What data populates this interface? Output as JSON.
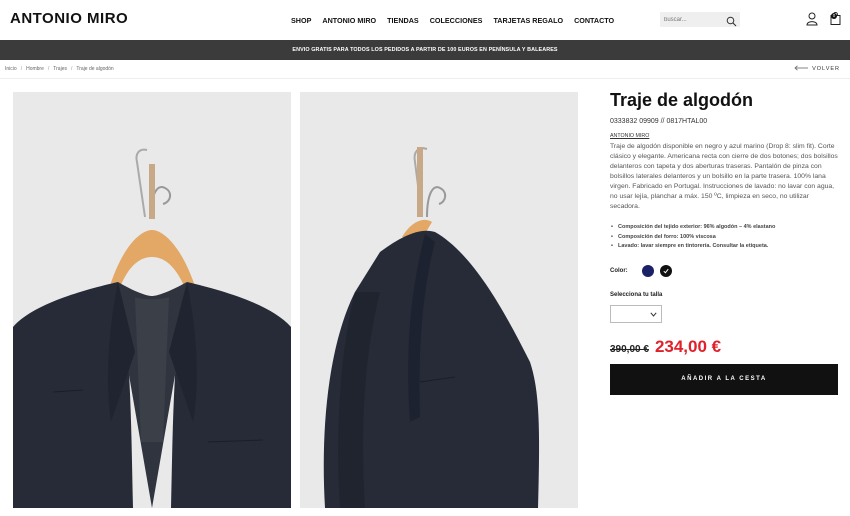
{
  "header": {
    "logo": "ANTONIO MIRO",
    "nav": [
      "SHOP",
      "ANTONIO MIRO",
      "TIENDAS",
      "COLECCIONES",
      "TARJETAS REGALO",
      "CONTACTO"
    ],
    "search_placeholder": "buscar...",
    "cart_count": "0"
  },
  "promo": "ENVIO GRATIS PARA TODOS LOS PEDIDOS A PARTIR DE 100 EUROS EN PENÍNSULA Y BALEARES",
  "breadcrumb": [
    "Inicio",
    "Hombre",
    "Trajes",
    "Traje de algodón"
  ],
  "back_label": "VOLVER",
  "product": {
    "title": "Traje de algodón",
    "ref": "0333832 09909 // 0817HTAL00",
    "brand": "ANTONIO MIRO",
    "description": "Traje de algodón disponible en negro y azul marino (Drop 8: slim fit). Corte clásico y elegante. Americana recta con cierre de dos botones; dos bolsillos delanteros con tapeta y dos aberturas traseras. Pantalón de pinza con bolsillos laterales delanteros y un bolsillo en la parte trasera. 100% lana virgen. Fabricado en Portugal. Instrucciones de lavado: no lavar con agua, no usar lejía, planchar a máx. 150 ºC, limpieza en seco, no utilizar secadora.",
    "bullets": [
      "Composición del tejido exterior: 96% algodón – 4% elastano",
      "Composición del forro: 100% viscosa",
      "Lavado: lavar siempre en tintorería. Consultar la etiqueta."
    ],
    "color_label": "Color:",
    "colors": [
      "#1b2166",
      "#111111"
    ],
    "size_label": "Selecciona tu talla",
    "old_price": "390,00 €",
    "new_price": "234,00 €",
    "add_to_cart": "AÑADIR A LA CESTA"
  }
}
